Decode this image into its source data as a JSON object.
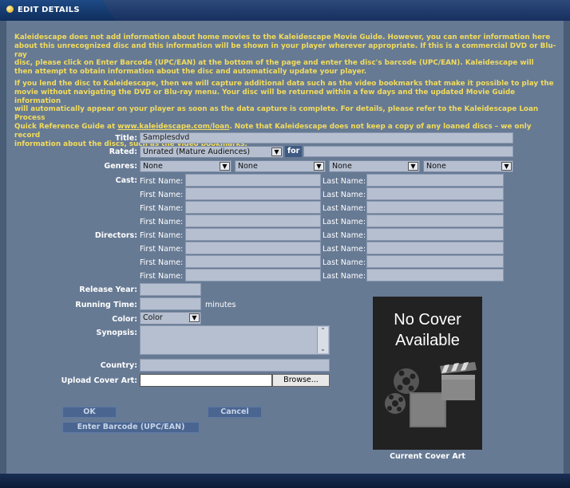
{
  "header": {
    "tab_label": "EDIT DETAILS"
  },
  "intro": {
    "p1_line1": "Kaleidescape does not add information about home movies to the Kaleidescape Movie Guide. However, you can enter information here",
    "p1_line2": "about this unrecognized disc and this information will be shown in your player wherever appropriate. If this is a commercial DVD or Blu-ray",
    "p1_line3a": "disc, please click on ",
    "p1_line3b": "Enter Barcode (UPC/EAN)",
    "p1_line3c": " at the bottom of the page and enter the disc's barcode (UPC/EAN). Kaleidescape will",
    "p1_line4": "then attempt to obtain information about the disc and automatically update your player.",
    "p2_line1": "If you lend the disc to Kaleidescape, then we will capture additional data such as the video bookmarks that make it possible to play the",
    "p2_line2": "movie without navigating the DVD or Blu-ray menu. Your disc will be returned within a few days and the updated Movie Guide information",
    "p2_line3": "will automatically appear on your player as soon as the data capture is complete. For details, please refer to the Kaleidescape Loan Process",
    "p2_line4a": "Quick Reference Guide at ",
    "p2_link": "www.kaleidescape.com/loan",
    "p2_line4b": ". Note that Kaleidescape does not keep a copy of any loaned discs – we only record",
    "p2_line5": "information about the discs, such as the video bookmarks."
  },
  "form": {
    "title_label": "Title:",
    "title_value": "Samplesdvd",
    "rated_label": "Rated:",
    "rated_value": "Unrated (Mature Audiences)",
    "for_label": "for",
    "genres_label": "Genres:",
    "genres": [
      "None",
      "None",
      "None",
      "None"
    ],
    "cast_label": "Cast:",
    "directors_label": "Directors:",
    "first_name_label": "First Name:",
    "last_name_label": "Last Name:",
    "release_year_label": "Release Year:",
    "running_time_label": "Running Time:",
    "minutes_label": "minutes",
    "color_label": "Color:",
    "color_value": "Color",
    "synopsis_label": "Synopsis:",
    "country_label": "Country:",
    "upload_label": "Upload Cover Art:",
    "browse_label": "Browse..."
  },
  "buttons": {
    "ok": "OK",
    "cancel": "Cancel",
    "barcode": "Enter Barcode (UPC/EAN)"
  },
  "cover": {
    "line1": "No Cover",
    "line2": "Available",
    "caption": "Current Cover Art"
  }
}
